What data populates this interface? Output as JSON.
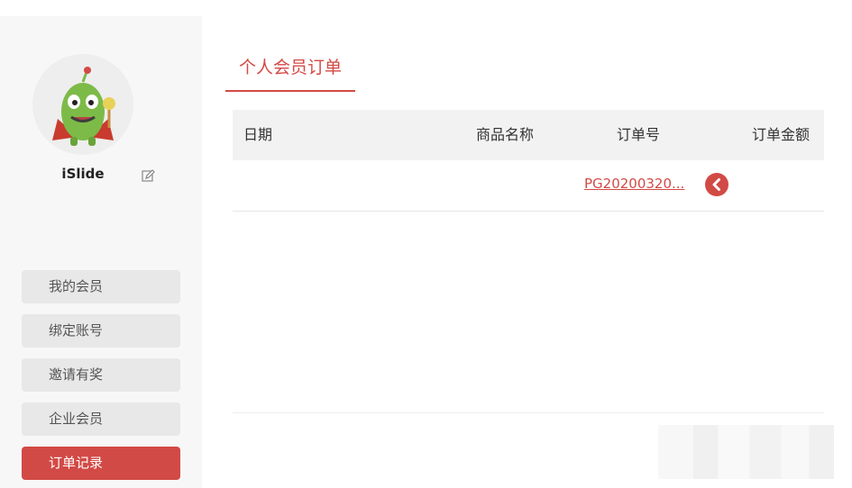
{
  "user": {
    "name": "iSlide",
    "avatar_icon": "mascot-avatar-icon"
  },
  "sidebar": {
    "items": [
      {
        "label": "我的会员",
        "active": false
      },
      {
        "label": "绑定账号",
        "active": false
      },
      {
        "label": "邀请有奖",
        "active": false
      },
      {
        "label": "企业会员",
        "active": false
      },
      {
        "label": "订单记录",
        "active": true
      }
    ]
  },
  "main": {
    "tab_label": "个人会员订单",
    "table": {
      "headers": [
        "日期",
        "商品名称",
        "订单号",
        "订单金额"
      ],
      "rows": [
        {
          "date": "",
          "product": "",
          "order_no": "PG20200320...",
          "amount": ""
        }
      ]
    }
  },
  "colors": {
    "accent": "#d24a46",
    "sidebar_bg": "#f7f7f7",
    "menu_bg": "#e8e8e8",
    "header_bg": "#f2f2f2"
  }
}
